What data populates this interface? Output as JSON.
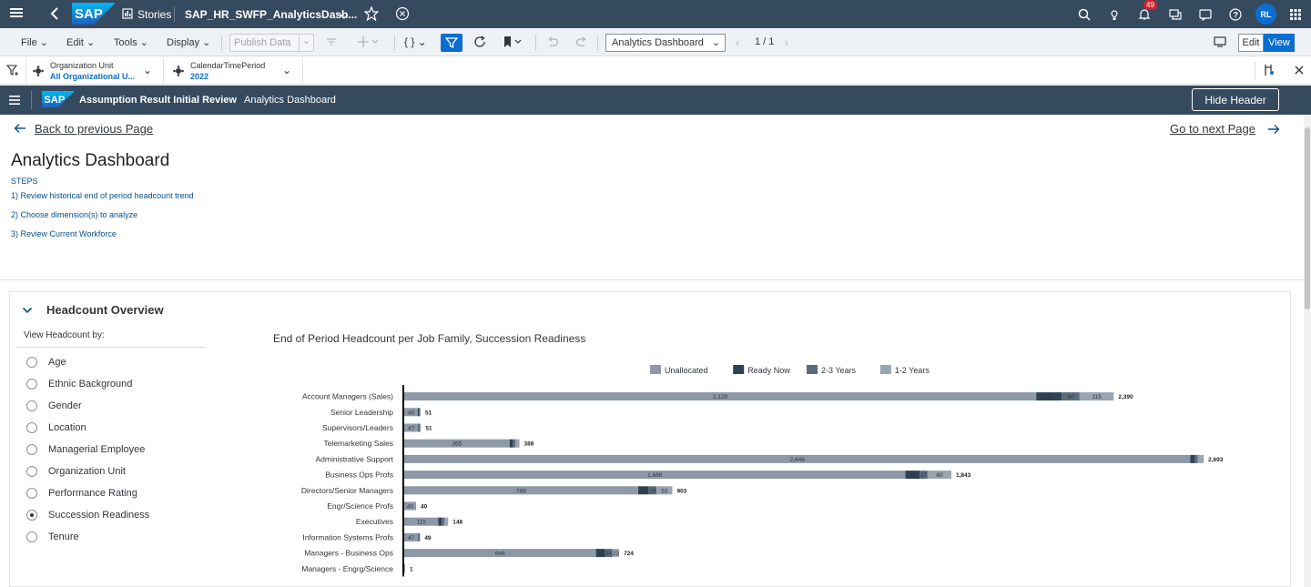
{
  "shell": {
    "stories_label": "Stories",
    "story_name": "SAP_HR_SWFP_AnalyticsDash...",
    "notification_count": "49",
    "avatar_initials": "RL"
  },
  "toolbar": {
    "file": "File",
    "edit": "Edit",
    "tools": "Tools",
    "display": "Display",
    "publish": "Publish Data",
    "page_select": "Analytics Dashboard",
    "page_counter": "1 / 1",
    "edit_btn": "Edit",
    "view_btn": "View"
  },
  "filters": [
    {
      "label": "Organization Unit",
      "value": "All Organizational U..."
    },
    {
      "label": "CalendarTimePeriod",
      "value": "2022"
    }
  ],
  "story_header": {
    "title": "Assumption Result Initial Review",
    "subtitle": "Analytics Dashboard",
    "hide_header": "Hide Header"
  },
  "nav": {
    "back": "Back to previous Page",
    "next": "Go to next Page"
  },
  "page": {
    "title": "Analytics Dashboard",
    "steps_label": "STEPS",
    "steps": [
      "1) Review historical end of period headcount trend",
      "2) Choose dimension(s) to analyze",
      "3) Review Current Workforce"
    ]
  },
  "panel": {
    "title": "Headcount Overview",
    "view_by": "View Headcount by:",
    "options": [
      "Age",
      "Ethnic Background",
      "Gender",
      "Location",
      "Managerial Employee",
      "Organization Unit",
      "Performance Rating",
      "Succession Readiness",
      "Tenure"
    ],
    "selected": "Succession Readiness"
  },
  "colors": {
    "unallocated": "#8d99a6",
    "ready_now": "#2f4254",
    "two_three": "#5b6b7b",
    "one_two": "#9aa5b1"
  },
  "chart_data": {
    "type": "bar",
    "orientation": "horizontal",
    "stacked": true,
    "title": "End of Period Headcount per Job Family, Succession Readiness",
    "legend_position": "top",
    "categories": [
      "Account Managers (Sales)",
      "Senior Leadership",
      "Supervisors/Leaders",
      "Telemarketing Sales",
      "Administrative Support",
      "Business Ops Profs",
      "Directors/Senior Managers",
      "Engr/Science Profs",
      "Executives",
      "Information Systems Profs",
      "Managers - Business Ops",
      "Managers - Engrg/Science"
    ],
    "series": [
      {
        "name": "Unallocated",
        "values": [
          2129,
          46,
          47,
          355,
          2648,
          1688,
          788,
          40,
          115,
          47,
          646,
          1
        ],
        "labels": [
          "2,129",
          "46",
          "47",
          "355",
          "2,648",
          "1,688",
          "788",
          "40",
          "115",
          "47",
          "646",
          ""
        ]
      },
      {
        "name": "Ready Now",
        "values": [
          86,
          3,
          2,
          10,
          15,
          48,
          36,
          0,
          11,
          1,
          31,
          0
        ],
        "labels": [
          "86",
          "",
          "",
          "",
          "",
          "48",
          "36",
          "",
          "",
          "",
          "31",
          ""
        ]
      },
      {
        "name": "2-3 Years",
        "values": [
          60,
          1,
          1,
          10,
          10,
          27,
          26,
          0,
          10,
          1,
          24,
          0
        ],
        "labels": [
          "60",
          "",
          "",
          "",
          "",
          "27",
          "26",
          "",
          "",
          "",
          "24",
          ""
        ]
      },
      {
        "name": "1-2 Years",
        "values": [
          115,
          1,
          1,
          13,
          20,
          80,
          53,
          0,
          12,
          0,
          23,
          0
        ],
        "labels": [
          "115",
          "",
          "",
          "",
          "",
          "80",
          "53",
          "",
          "",
          "",
          "23",
          ""
        ]
      }
    ],
    "totals": [
      "2,390",
      "51",
      "51",
      "388",
      "2,693",
      "1,843",
      "903",
      "40",
      "148",
      "49",
      "724",
      "1"
    ],
    "xlim": [
      0,
      2760
    ]
  }
}
